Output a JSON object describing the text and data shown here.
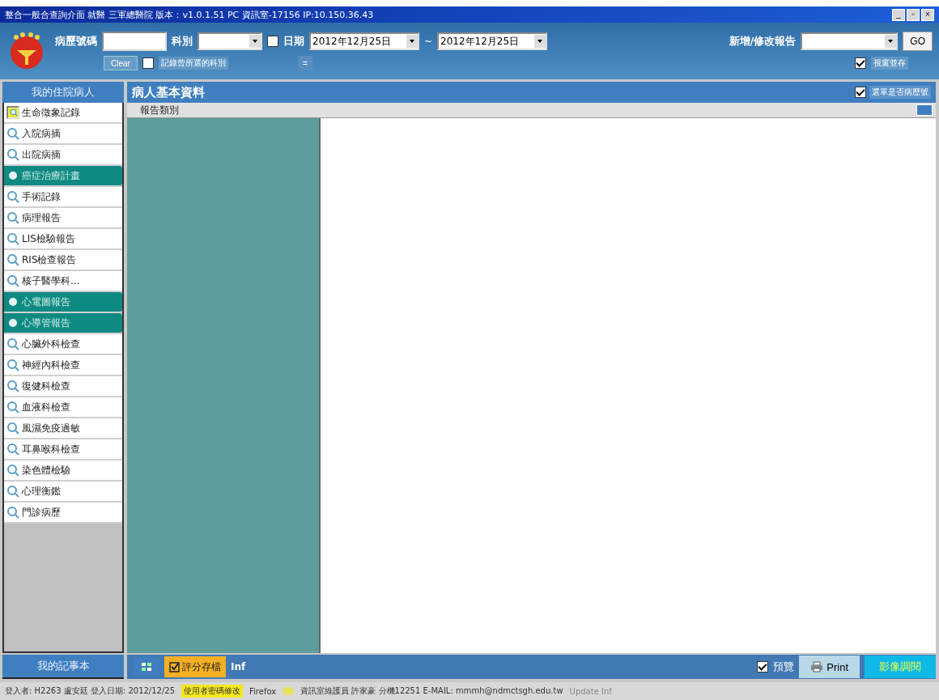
{
  "window": {
    "title": "整合一般合查詢介面 就醫 三軍總醫院 版本：v1.0.1.51 PC 資訊室-17156 IP:10.150.36.43",
    "controls": [
      "_",
      "▫",
      "×"
    ]
  },
  "toolbar": {
    "chart_no": {
      "label": "病歷號碼"
    },
    "department": {
      "label": "科別"
    },
    "date_filter": {
      "label": "日期",
      "checked": false,
      "from": "2012年12月25日",
      "to": "2012年12月25日",
      "separator": "~"
    },
    "clear_button": "Clear",
    "remember_department": {
      "label": "記錄曾所選的科別",
      "checked": false
    },
    "equals_button": "=",
    "report_edit": {
      "label": "新增/修改報告"
    },
    "go_button": "GO",
    "window_coexist": {
      "label": "視窗並存",
      "checked": true
    }
  },
  "sidebar": {
    "header": "我的住院病人",
    "items": [
      {
        "label": "生命徵象記錄",
        "highlighted": false,
        "selected": true
      },
      {
        "label": "入院病摘",
        "highlighted": false,
        "selected": false
      },
      {
        "label": "出院病摘",
        "highlighted": false,
        "selected": false
      },
      {
        "label": "癌症治療計畫",
        "highlighted": true,
        "selected": false
      },
      {
        "label": "手術記錄",
        "highlighted": false,
        "selected": false
      },
      {
        "label": "病理報告",
        "highlighted": false,
        "selected": false
      },
      {
        "label": "LIS檢驗報告",
        "highlighted": false,
        "selected": false
      },
      {
        "label": "RIS檢查報告",
        "highlighted": false,
        "selected": false
      },
      {
        "label": "核子醫學科...",
        "highlighted": false,
        "selected": false
      },
      {
        "label": "心電圖報告",
        "highlighted": true,
        "selected": false
      },
      {
        "label": "心導管報告",
        "highlighted": true,
        "selected": false
      },
      {
        "label": "心臟外科檢查",
        "highlighted": false,
        "selected": false
      },
      {
        "label": "神經內科檢查",
        "highlighted": false,
        "selected": false
      },
      {
        "label": "復健科檢查",
        "highlighted": false,
        "selected": false
      },
      {
        "label": "血液科檢查",
        "highlighted": false,
        "selected": false
      },
      {
        "label": "風濕免疫過敏",
        "highlighted": false,
        "selected": false
      },
      {
        "label": "耳鼻喉科檢查",
        "highlighted": false,
        "selected": false
      },
      {
        "label": "染色體檢驗",
        "highlighted": false,
        "selected": false
      },
      {
        "label": "心理衡鑑",
        "highlighted": false,
        "selected": false
      },
      {
        "label": "門診病歷",
        "highlighted": false,
        "selected": false
      }
    ],
    "footer_button": "我的記事本"
  },
  "main": {
    "title": "病人基本資料",
    "list_option": {
      "label": "選單是否病歷號",
      "checked": true
    },
    "report_category": "報告類別"
  },
  "bottom_bar": {
    "score_button": "評分存檔",
    "inf": "Inf",
    "preview": {
      "label": "預覽",
      "checked": true
    },
    "print_button": "Print",
    "image_button": "影像調閱"
  },
  "status_bar": {
    "login": "登入者: H2263 盧安廷 登入日期: 2012/12/25",
    "password_link": "使用者密碼修改",
    "browser": "Firefox",
    "maintainer": "資訊室維護員 許家豪 分機12251 E-MAIL: mmmh@ndmctsgh.edu.tw",
    "update": "Update Inf"
  }
}
